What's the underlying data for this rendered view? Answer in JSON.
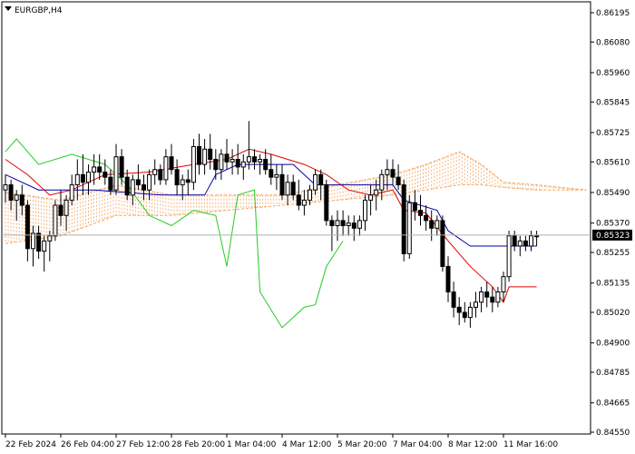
{
  "chart_data": {
    "type": "candlestick",
    "title": "EURGBP,H4",
    "current_price": "0.85323",
    "ylim": [
      0.8455,
      0.8623
    ],
    "y_ticks": [
      "0.86195",
      "0.86080",
      "0.85960",
      "0.85845",
      "0.85725",
      "0.85610",
      "0.85490",
      "0.85370",
      "0.85255",
      "0.85135",
      "0.85020",
      "0.84900",
      "0.84785",
      "0.84665",
      "0.84550"
    ],
    "x_ticks": [
      "22 Feb 2024",
      "26 Feb 04:00",
      "27 Feb 12:00",
      "28 Feb 20:00",
      "1 Mar 04:00",
      "4 Mar 12:00",
      "5 Mar 20:00",
      "7 Mar 04:00",
      "8 Mar 12:00",
      "11 Mar 16:00"
    ],
    "x_tick_bars": [
      0,
      10,
      20,
      30,
      40,
      50,
      60,
      70,
      80,
      90
    ],
    "total_bars": 97,
    "candles": [
      [
        0.855,
        0.8556,
        0.8545,
        0.8552
      ],
      [
        0.8552,
        0.8554,
        0.8542,
        0.8546
      ],
      [
        0.8546,
        0.855,
        0.8538,
        0.8548
      ],
      [
        0.8548,
        0.8552,
        0.854,
        0.8544
      ],
      [
        0.8544,
        0.8546,
        0.8522,
        0.8527
      ],
      [
        0.8527,
        0.8536,
        0.852,
        0.8533
      ],
      [
        0.8533,
        0.8536,
        0.8523,
        0.8526
      ],
      [
        0.8526,
        0.8532,
        0.8518,
        0.853
      ],
      [
        0.853,
        0.8534,
        0.8522,
        0.8532
      ],
      [
        0.8532,
        0.8546,
        0.853,
        0.8544
      ],
      [
        0.8544,
        0.855,
        0.8536,
        0.854
      ],
      [
        0.854,
        0.8548,
        0.8534,
        0.8546
      ],
      [
        0.8546,
        0.8556,
        0.8544,
        0.8552
      ],
      [
        0.8552,
        0.8562,
        0.8546,
        0.8556
      ],
      [
        0.8556,
        0.8564,
        0.8548,
        0.8553
      ],
      [
        0.8553,
        0.856,
        0.8548,
        0.8557
      ],
      [
        0.8557,
        0.8564,
        0.8552,
        0.8559
      ],
      [
        0.8559,
        0.8564,
        0.8554,
        0.8557
      ],
      [
        0.8557,
        0.8562,
        0.8552,
        0.8555
      ],
      [
        0.8555,
        0.8558,
        0.8548,
        0.855
      ],
      [
        0.855,
        0.8568,
        0.8548,
        0.8563
      ],
      [
        0.8563,
        0.8566,
        0.8552,
        0.8555
      ],
      [
        0.8555,
        0.8558,
        0.8546,
        0.8548
      ],
      [
        0.8548,
        0.8556,
        0.8544,
        0.8554
      ],
      [
        0.8554,
        0.856,
        0.855,
        0.8552
      ],
      [
        0.8552,
        0.8556,
        0.8546,
        0.855
      ],
      [
        0.855,
        0.8558,
        0.8546,
        0.8556
      ],
      [
        0.8556,
        0.8562,
        0.8552,
        0.8558
      ],
      [
        0.8558,
        0.856,
        0.8552,
        0.8554
      ],
      [
        0.8554,
        0.8566,
        0.8552,
        0.8563
      ],
      [
        0.8563,
        0.8568,
        0.8556,
        0.8558
      ],
      [
        0.8558,
        0.8562,
        0.8548,
        0.8552
      ],
      [
        0.8552,
        0.8556,
        0.8546,
        0.8554
      ],
      [
        0.8554,
        0.8558,
        0.8548,
        0.8553
      ],
      [
        0.8553,
        0.857,
        0.855,
        0.8567
      ],
      [
        0.8567,
        0.8572,
        0.8556,
        0.856
      ],
      [
        0.856,
        0.857,
        0.8556,
        0.8566
      ],
      [
        0.8566,
        0.8572,
        0.8558,
        0.8562
      ],
      [
        0.8562,
        0.8566,
        0.8554,
        0.8558
      ],
      [
        0.8558,
        0.8566,
        0.8554,
        0.8564
      ],
      [
        0.8564,
        0.857,
        0.8558,
        0.8561
      ],
      [
        0.8561,
        0.8566,
        0.8556,
        0.8562
      ],
      [
        0.8562,
        0.8568,
        0.8556,
        0.8559
      ],
      [
        0.8559,
        0.8564,
        0.8554,
        0.8561
      ],
      [
        0.8561,
        0.8577,
        0.8558,
        0.8563
      ],
      [
        0.8563,
        0.8566,
        0.8558,
        0.8561
      ],
      [
        0.8561,
        0.8564,
        0.8556,
        0.8562
      ],
      [
        0.8562,
        0.8566,
        0.8556,
        0.8558
      ],
      [
        0.8558,
        0.8564,
        0.8552,
        0.8555
      ],
      [
        0.8555,
        0.856,
        0.855,
        0.8556
      ],
      [
        0.8556,
        0.856,
        0.8546,
        0.8548
      ],
      [
        0.8548,
        0.8556,
        0.8544,
        0.8553
      ],
      [
        0.8553,
        0.8556,
        0.8546,
        0.8548
      ],
      [
        0.8548,
        0.8554,
        0.8542,
        0.8544
      ],
      [
        0.8544,
        0.855,
        0.854,
        0.8546
      ],
      [
        0.8546,
        0.8552,
        0.8544,
        0.855
      ],
      [
        0.855,
        0.8558,
        0.8548,
        0.8556
      ],
      [
        0.8556,
        0.8558,
        0.8546,
        0.8552
      ],
      [
        0.8552,
        0.8554,
        0.8536,
        0.8538
      ],
      [
        0.8538,
        0.854,
        0.8526,
        0.8536
      ],
      [
        0.8536,
        0.8542,
        0.853,
        0.8538
      ],
      [
        0.8538,
        0.8542,
        0.8532,
        0.8536
      ],
      [
        0.8536,
        0.854,
        0.8532,
        0.8537
      ],
      [
        0.8537,
        0.854,
        0.853,
        0.8535
      ],
      [
        0.8535,
        0.854,
        0.8532,
        0.8538
      ],
      [
        0.8538,
        0.8548,
        0.8534,
        0.8546
      ],
      [
        0.8546,
        0.8552,
        0.854,
        0.8548
      ],
      [
        0.8548,
        0.8554,
        0.8542,
        0.855
      ],
      [
        0.855,
        0.8558,
        0.8546,
        0.8556
      ],
      [
        0.8556,
        0.8562,
        0.855,
        0.8558
      ],
      [
        0.8558,
        0.8562,
        0.8552,
        0.8555
      ],
      [
        0.8555,
        0.856,
        0.855,
        0.8552
      ],
      [
        0.8552,
        0.8554,
        0.8522,
        0.8525
      ],
      [
        0.8525,
        0.8548,
        0.8523,
        0.8545
      ],
      [
        0.8545,
        0.855,
        0.8538,
        0.8542
      ],
      [
        0.8542,
        0.8548,
        0.8536,
        0.854
      ],
      [
        0.854,
        0.8544,
        0.8534,
        0.8538
      ],
      [
        0.8538,
        0.8542,
        0.853,
        0.8535
      ],
      [
        0.8535,
        0.854,
        0.8532,
        0.8538
      ],
      [
        0.8538,
        0.854,
        0.8518,
        0.852
      ],
      [
        0.852,
        0.8524,
        0.8506,
        0.851
      ],
      [
        0.851,
        0.8514,
        0.85,
        0.8504
      ],
      [
        0.8504,
        0.8508,
        0.8497,
        0.8502
      ],
      [
        0.8502,
        0.8506,
        0.8498,
        0.85
      ],
      [
        0.85,
        0.8506,
        0.8496,
        0.8504
      ],
      [
        0.8504,
        0.851,
        0.85,
        0.8506
      ],
      [
        0.8506,
        0.8512,
        0.8502,
        0.851
      ],
      [
        0.851,
        0.8514,
        0.8504,
        0.8508
      ],
      [
        0.8508,
        0.8512,
        0.8502,
        0.8506
      ],
      [
        0.8506,
        0.8512,
        0.8504,
        0.851
      ],
      [
        0.851,
        0.8518,
        0.8506,
        0.8516
      ],
      [
        0.8516,
        0.8534,
        0.8514,
        0.8532
      ],
      [
        0.8532,
        0.8534,
        0.8526,
        0.8528
      ],
      [
        0.8528,
        0.8532,
        0.8524,
        0.853
      ],
      [
        0.853,
        0.8532,
        0.8526,
        0.8528
      ],
      [
        0.8528,
        0.8534,
        0.8526,
        0.8532
      ],
      [
        0.8532,
        0.8534,
        0.8528,
        0.8532
      ]
    ],
    "indicators": {
      "tenkan_color": "#dd0000",
      "kijun_color": "#0000aa",
      "chikou_color": "#22cc22",
      "cloud_color": "#f4a460",
      "tenkan": [
        [
          0,
          0.8562
        ],
        [
          4,
          0.8556
        ],
        [
          8,
          0.8548
        ],
        [
          12,
          0.855
        ],
        [
          18,
          0.8556
        ],
        [
          26,
          0.8557
        ],
        [
          34,
          0.856
        ],
        [
          40,
          0.8562
        ],
        [
          44,
          0.8566
        ],
        [
          48,
          0.8564
        ],
        [
          54,
          0.856
        ],
        [
          58,
          0.8556
        ],
        [
          62,
          0.855
        ],
        [
          66,
          0.8548
        ],
        [
          70,
          0.855
        ],
        [
          72,
          0.8542
        ],
        [
          76,
          0.8541
        ],
        [
          80,
          0.853
        ],
        [
          84,
          0.852
        ],
        [
          88,
          0.8512
        ],
        [
          90,
          0.8506
        ],
        [
          91,
          0.8512
        ],
        [
          96,
          0.8512
        ]
      ],
      "kijun": [
        [
          0,
          0.8556
        ],
        [
          6,
          0.855
        ],
        [
          16,
          0.855
        ],
        [
          28,
          0.8548
        ],
        [
          36,
          0.8548
        ],
        [
          38,
          0.8556
        ],
        [
          42,
          0.856
        ],
        [
          52,
          0.856
        ],
        [
          56,
          0.8552
        ],
        [
          70,
          0.8552
        ],
        [
          72,
          0.8546
        ],
        [
          78,
          0.8542
        ],
        [
          80,
          0.8534
        ],
        [
          84,
          0.8528
        ],
        [
          90,
          0.8528
        ],
        [
          96,
          0.8528
        ]
      ],
      "chikou": [
        [
          0,
          0.8565
        ],
        [
          2,
          0.857
        ],
        [
          6,
          0.856
        ],
        [
          12,
          0.8564
        ],
        [
          18,
          0.856
        ],
        [
          22,
          0.8552
        ],
        [
          26,
          0.854
        ],
        [
          30,
          0.8536
        ],
        [
          34,
          0.8542
        ],
        [
          38,
          0.854
        ],
        [
          40,
          0.852
        ],
        [
          42,
          0.8548
        ],
        [
          45,
          0.855
        ],
        [
          46,
          0.851
        ],
        [
          50,
          0.8496
        ],
        [
          54,
          0.8504
        ],
        [
          56,
          0.8505
        ],
        [
          58,
          0.852
        ],
        [
          61,
          0.853
        ]
      ],
      "cloud_a": [
        [
          0,
          0.8549
        ],
        [
          10,
          0.8546
        ],
        [
          20,
          0.8552
        ],
        [
          30,
          0.8548
        ],
        [
          40,
          0.8548
        ],
        [
          50,
          0.8548
        ],
        [
          60,
          0.8552
        ],
        [
          70,
          0.8556
        ],
        [
          76,
          0.856
        ],
        [
          82,
          0.8565
        ],
        [
          86,
          0.856
        ],
        [
          90,
          0.8553
        ],
        [
          96,
          0.8552
        ],
        [
          105,
          0.855
        ]
      ],
      "cloud_b": [
        [
          0,
          0.8529
        ],
        [
          10,
          0.8532
        ],
        [
          20,
          0.854
        ],
        [
          30,
          0.854
        ],
        [
          40,
          0.8542
        ],
        [
          50,
          0.8544
        ],
        [
          60,
          0.8546
        ],
        [
          70,
          0.8548
        ],
        [
          76,
          0.855
        ],
        [
          82,
          0.8552
        ],
        [
          86,
          0.8552
        ],
        [
          90,
          0.8551
        ],
        [
          96,
          0.855
        ],
        [
          105,
          0.855
        ]
      ]
    }
  }
}
